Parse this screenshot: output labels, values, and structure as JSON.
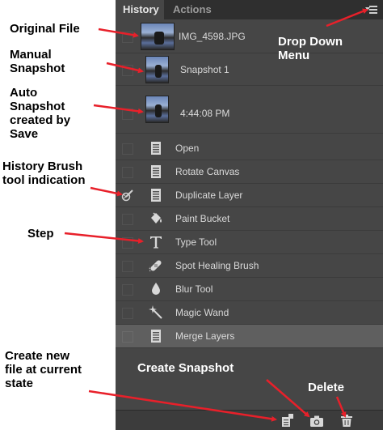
{
  "panel": {
    "tabs": [
      {
        "label": "History"
      },
      {
        "label": "Actions"
      }
    ]
  },
  "snapshots": [
    {
      "label": "IMG_4598.JPG"
    },
    {
      "label": "Snapshot 1"
    },
    {
      "label": "4:44:08 PM"
    }
  ],
  "steps": [
    {
      "label": "Open",
      "icon": "document-icon"
    },
    {
      "label": "Rotate Canvas",
      "icon": "document-icon"
    },
    {
      "label": "Duplicate Layer",
      "icon": "document-icon"
    },
    {
      "label": "Paint Bucket",
      "icon": "paint-bucket-icon"
    },
    {
      "label": "Type Tool",
      "icon": "type-icon"
    },
    {
      "label": "Spot Healing Brush",
      "icon": "bandage-icon"
    },
    {
      "label": "Blur Tool",
      "icon": "drop-icon"
    },
    {
      "label": "Magic Wand",
      "icon": "magic-wand-icon"
    },
    {
      "label": "Merge Layers",
      "icon": "document-icon"
    }
  ],
  "annotations": {
    "original_file": "Original File",
    "manual_snapshot": [
      "Manual",
      "Snapshot"
    ],
    "auto_snapshot": [
      "Auto",
      "Snapshot",
      "created by",
      "Save"
    ],
    "history_brush": [
      "History Brush",
      "tool indication"
    ],
    "step": "Step",
    "create_new_file": [
      "Create new",
      "file at current",
      "state"
    ],
    "drop_down_menu": [
      "Drop Down",
      "Menu"
    ],
    "create_snapshot": "Create Snapshot",
    "delete": "Delete"
  },
  "colors": {
    "panel_bg": "#464646",
    "tabbar_bg": "#2f2f2f",
    "selected_row": "#5f5f5f",
    "arrow_red": "#e8202a"
  }
}
